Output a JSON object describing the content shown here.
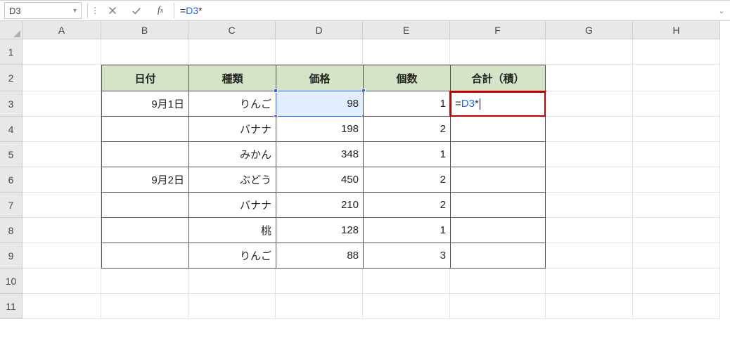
{
  "name_box": {
    "value": "D3"
  },
  "formula_bar": {
    "eq": "=",
    "ref": "D3",
    "op": "*"
  },
  "columns": [
    "A",
    "B",
    "C",
    "D",
    "E",
    "F",
    "G",
    "H"
  ],
  "rows": [
    "1",
    "2",
    "3",
    "4",
    "5",
    "6",
    "7",
    "8",
    "9",
    "10",
    "11"
  ],
  "headers": {
    "b": "日付",
    "c": "種類",
    "d": "価格",
    "e": "個数",
    "f": "合計（積）"
  },
  "table": {
    "r3": {
      "b": "9月1日",
      "c": "りんご",
      "d": "98",
      "e": "1"
    },
    "r4": {
      "b": "",
      "c": "バナナ",
      "d": "198",
      "e": "2"
    },
    "r5": {
      "b": "",
      "c": "みかん",
      "d": "348",
      "e": "1"
    },
    "r6": {
      "b": "9月2日",
      "c": "ぶどう",
      "d": "450",
      "e": "2"
    },
    "r7": {
      "b": "",
      "c": "バナナ",
      "d": "210",
      "e": "2"
    },
    "r8": {
      "b": "",
      "c": "桃",
      "d": "128",
      "e": "1"
    },
    "r9": {
      "b": "",
      "c": "りんご",
      "d": "88",
      "e": "3"
    }
  },
  "active_cell": {
    "address": "F3",
    "eq": "=",
    "ref": "D3",
    "op": "*"
  }
}
